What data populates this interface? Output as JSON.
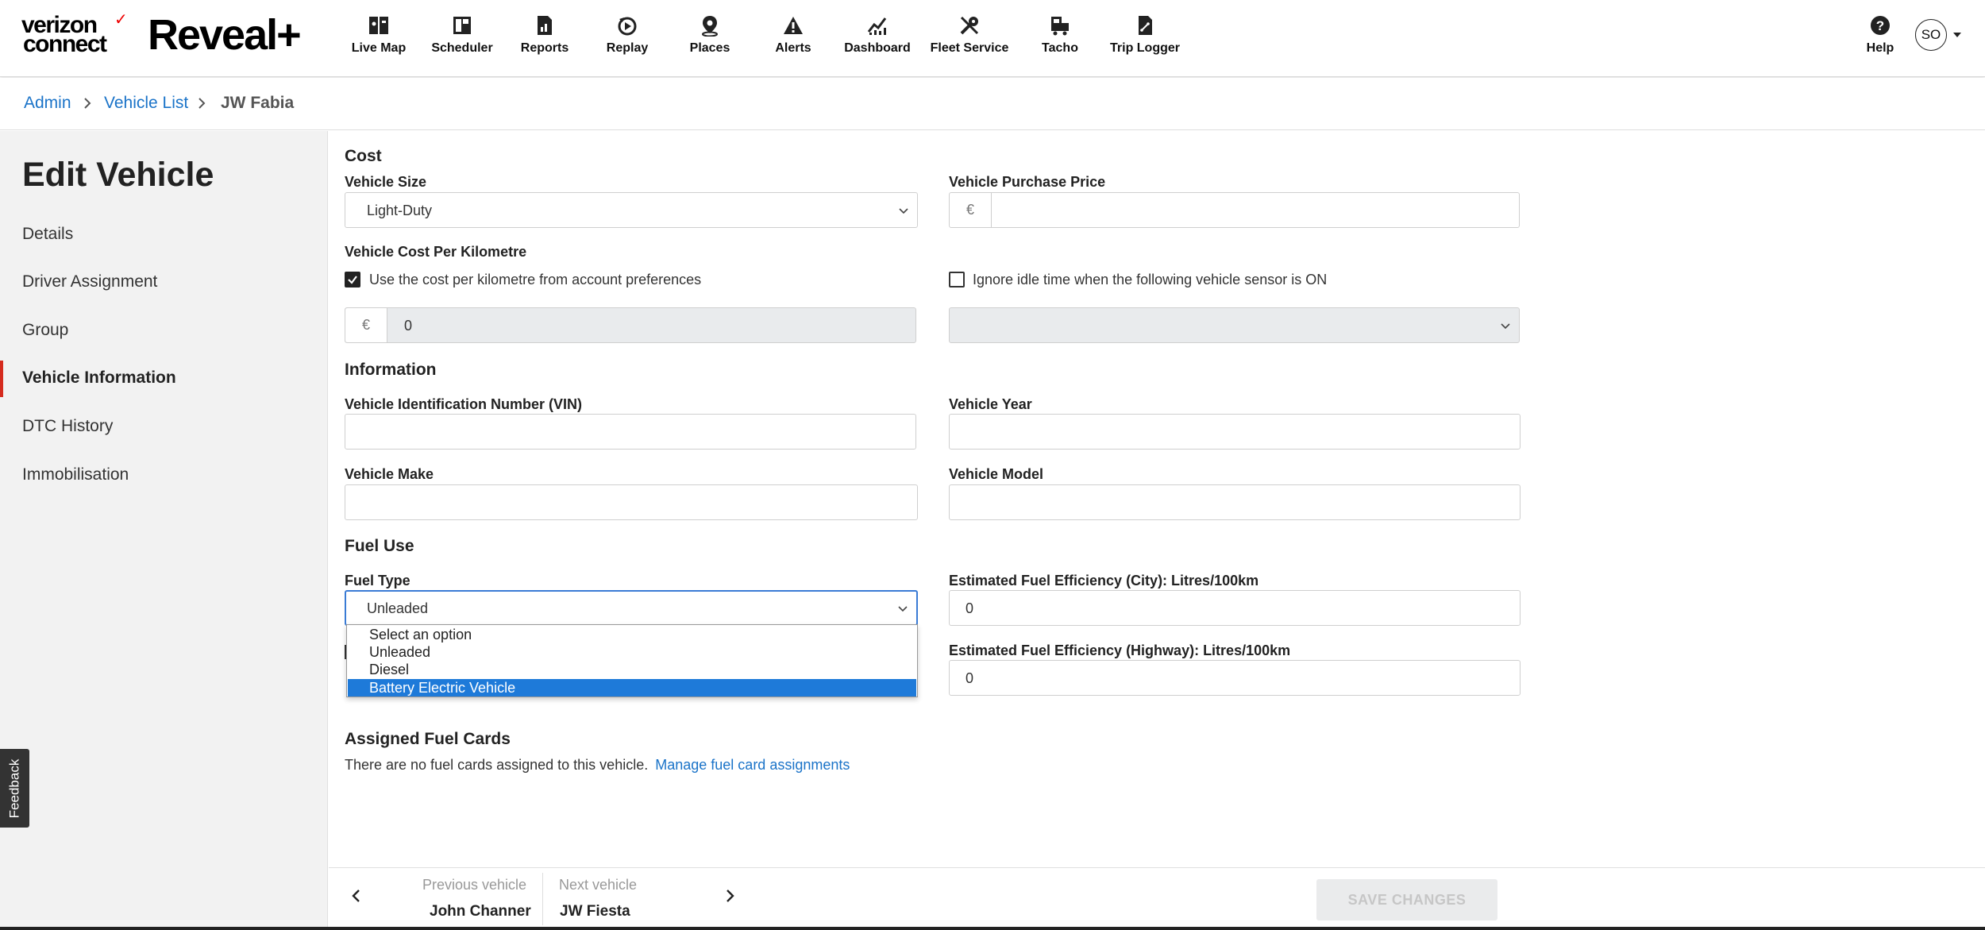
{
  "brand": {
    "company_line1": "verizon",
    "company_line2": "connect",
    "product": "Reveal+"
  },
  "nav": [
    {
      "label": "Live Map",
      "icon": "live-map-icon"
    },
    {
      "label": "Scheduler",
      "icon": "scheduler-icon"
    },
    {
      "label": "Reports",
      "icon": "reports-icon"
    },
    {
      "label": "Replay",
      "icon": "replay-icon"
    },
    {
      "label": "Places",
      "icon": "places-icon"
    },
    {
      "label": "Alerts",
      "icon": "alerts-icon"
    },
    {
      "label": "Dashboard",
      "icon": "dashboard-icon"
    },
    {
      "label": "Fleet Service",
      "icon": "fleet-service-icon"
    },
    {
      "label": "Tacho",
      "icon": "tacho-icon"
    },
    {
      "label": "Trip Logger",
      "icon": "trip-logger-icon"
    }
  ],
  "help_label": "Help",
  "user_initials": "SO",
  "breadcrumb": {
    "admin": "Admin",
    "vehicle_list": "Vehicle List",
    "current": "JW Fabia"
  },
  "sidebar": {
    "title": "Edit Vehicle",
    "items": [
      "Details",
      "Driver Assignment",
      "Group",
      "Vehicle Information",
      "DTC History",
      "Immobilisation"
    ],
    "active": "Vehicle Information"
  },
  "feedback": "Feedback",
  "cost": {
    "heading": "Cost",
    "vehicle_size_label": "Vehicle Size",
    "vehicle_size_value": "Light-Duty",
    "purchase_price_label": "Vehicle Purchase Price",
    "currency": "€",
    "purchase_price_value": "",
    "cost_per_km_label": "Vehicle Cost Per Kilometre",
    "use_account_pref_label": "Use the cost per kilometre from account preferences",
    "use_account_pref_checked": true,
    "ignore_idle_label": "Ignore idle time when the following vehicle sensor is ON",
    "ignore_idle_checked": false,
    "cost_value": "0",
    "sensor_value": ""
  },
  "information": {
    "heading": "Information",
    "vin_label": "Vehicle Identification Number (VIN)",
    "vin_value": "",
    "year_label": "Vehicle Year",
    "year_value": "",
    "make_label": "Vehicle Make",
    "make_value": "",
    "model_label": "Vehicle Model",
    "model_value": ""
  },
  "fuel": {
    "heading": "Fuel Use",
    "type_label": "Fuel Type",
    "type_value": "Unleaded",
    "type_options": [
      "Select an option",
      "Unleaded",
      "Diesel",
      "Battery Electric Vehicle"
    ],
    "highlighted_option": "Battery Electric Vehicle",
    "city_label": "Estimated Fuel Efficiency (City):  Litres/100km",
    "city_value": "0",
    "highway_label": "Estimated Fuel Efficiency (Highway):  Litres/100km",
    "highway_value": "0"
  },
  "fuel_cards": {
    "heading": "Assigned Fuel Cards",
    "empty_text": "There are no fuel cards assigned to this vehicle.",
    "manage_link": "Manage fuel card assignments"
  },
  "footer": {
    "prev_label": "Previous vehicle",
    "prev_name": "John Channer",
    "next_label": "Next vehicle",
    "next_name": "JW Fiesta",
    "save_label": "SAVE CHANGES"
  }
}
